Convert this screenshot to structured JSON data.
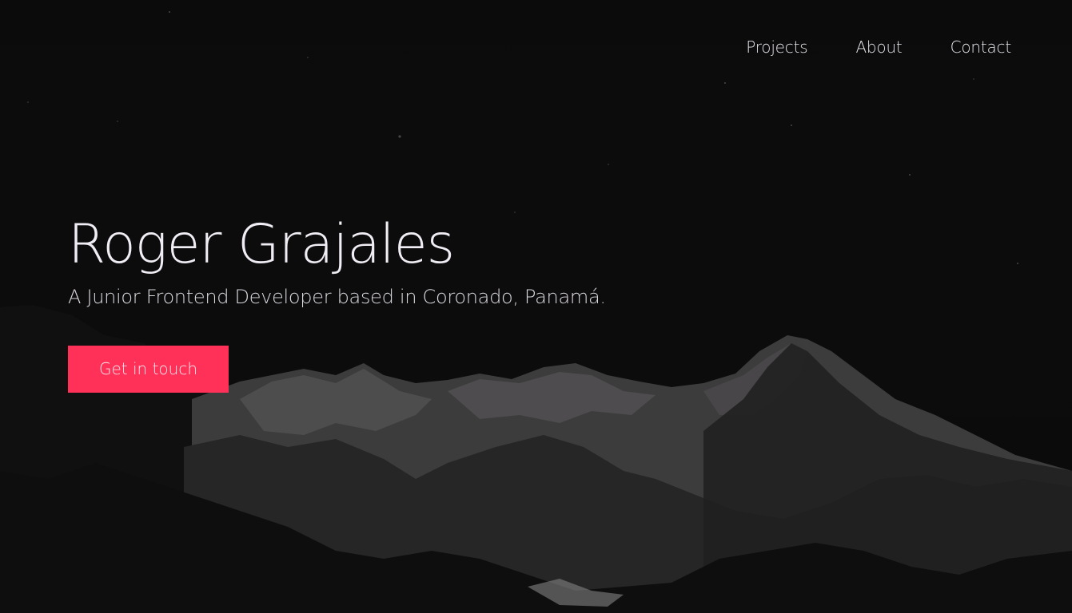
{
  "nav": {
    "items": [
      {
        "label": "Projects"
      },
      {
        "label": "About"
      },
      {
        "label": "Contact"
      }
    ]
  },
  "hero": {
    "title": "Roger Grajales",
    "subtitle": "A Junior Frontend Developer based in Coronado, Panamá.",
    "cta_label": "Get in touch",
    "background_image": "dark-mountains-night-sky"
  },
  "colors": {
    "background": "#0e0d0e",
    "accent": "#ff3159",
    "text": "#f1edf4"
  }
}
